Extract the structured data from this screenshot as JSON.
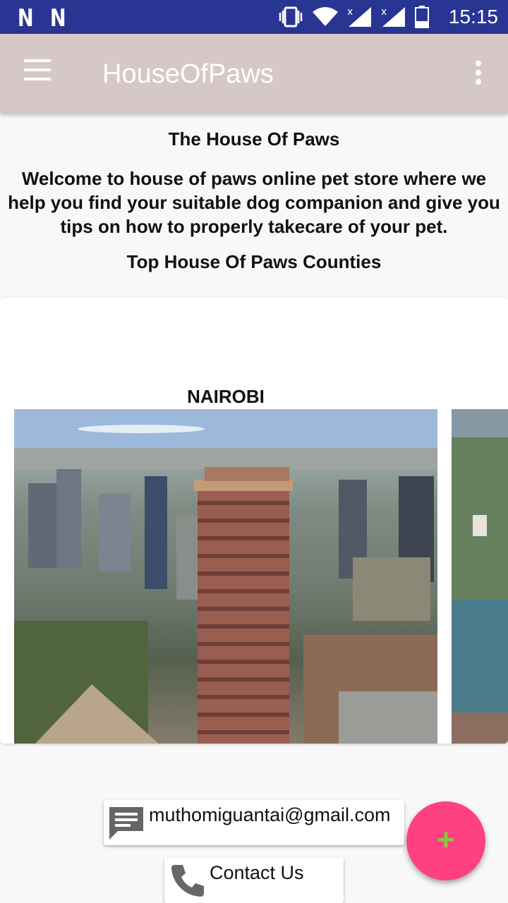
{
  "status_bar": {
    "left_icons": [
      "N",
      "N"
    ],
    "icons": [
      "vibrate-icon",
      "wifi-icon",
      "signal-icon",
      "signal-icon",
      "battery-icon"
    ],
    "time": "15:15"
  },
  "app_bar": {
    "title": "HouseOfPaws",
    "menu_icon": "hamburger-menu-icon",
    "overflow_icon": "more-vert-icon"
  },
  "content": {
    "heading": "The House Of Paws",
    "intro": "Welcome to house of paws online pet store where we help you find your suitable dog companion and give you tips on how to properly takecare of your pet.",
    "section_title": "Top House Of Paws Counties"
  },
  "carousel": {
    "items": [
      {
        "label": "NAIROBI"
      }
    ]
  },
  "contacts": {
    "email": "muthomiguantai@gmail.com",
    "email_icon": "message-icon",
    "phone_label": "Contact Us",
    "phone_icon": "phone-icon"
  },
  "fab": {
    "symbol": "+",
    "icon": "add-icon"
  },
  "colors": {
    "status_bar": "#283593",
    "app_bar": "#d7c8c8",
    "fab": "#ff4081",
    "fab_symbol": "#8bc34a"
  }
}
